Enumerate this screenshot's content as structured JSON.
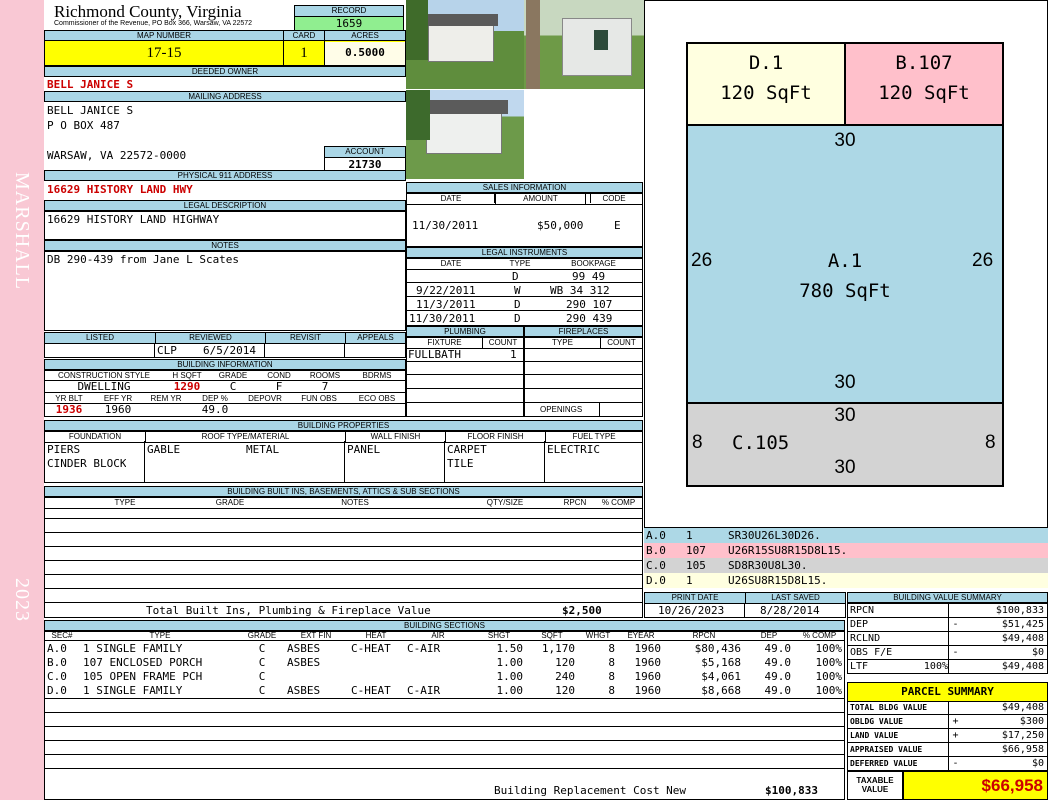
{
  "side": {
    "top_text": "MARSHALL",
    "bottom_text": "2023"
  },
  "header": {
    "county": "Richmond County, Virginia",
    "office": "Commissioner of the Revenue, PO Box 366, Warsaw, VA 22572",
    "record_label": "RECORD",
    "record": "1659",
    "map_label": "MAP NUMBER",
    "map": "17-15",
    "card_label": "CARD",
    "card": "1",
    "acres_label": "ACRES",
    "acres": "0.5000"
  },
  "owner": {
    "deeded_label": "DEEDED OWNER",
    "deeded": "BELL JANICE S",
    "mailing_label": "MAILING ADDRESS",
    "mail_lines": [
      "BELL JANICE S",
      "P O BOX 487",
      "",
      "WARSAW, VA 22572-0000"
    ],
    "account_label": "ACCOUNT",
    "account": "21730",
    "physical_label": "PHYSICAL 911 ADDRESS",
    "physical": "16629 HISTORY LAND HWY",
    "legal_label": "LEGAL DESCRIPTION",
    "legal": "16629 HISTORY LAND HIGHWAY",
    "notes_label": "NOTES",
    "notes": "DB 290-439 from Jane L Scates"
  },
  "review": {
    "listed_label": "LISTED",
    "reviewed_label": "REVIEWED",
    "revisit_label": "REVISIT",
    "appeals_label": "APPEALS",
    "reviewer": "CLP",
    "reviewed_date": "6/5/2014"
  },
  "building_info": {
    "title": "BUILDING INFORMATION",
    "h1": [
      "CONSTRUCTION STYLE",
      "H SQFT",
      "GRADE",
      "COND",
      "ROOMS",
      "BDRMS"
    ],
    "v1": [
      "DWELLING",
      "1290",
      "C",
      "F",
      "7",
      ""
    ],
    "h2": [
      "YR BLT",
      "EFF YR",
      "REM YR",
      "DEP %",
      "DEPOVR",
      "FUN OBS",
      "ECO OBS"
    ],
    "v2": [
      "1936",
      "1960",
      "",
      "49.0",
      "",
      "",
      ""
    ]
  },
  "sales": {
    "title": "SALES INFORMATION",
    "headers": [
      "DATE",
      "AMOUNT",
      "CODE"
    ],
    "rows": [
      [
        "11/30/2011",
        "$50,000",
        "E"
      ]
    ]
  },
  "legal_inst": {
    "title": "LEGAL INSTRUMENTS",
    "headers": [
      "DATE",
      "TYPE",
      "BOOKPAGE"
    ],
    "rows": [
      [
        "",
        "D",
        "99 49"
      ],
      [
        "9/22/2011",
        "W",
        "WB 34 312"
      ],
      [
        "11/3/2011",
        "D",
        "290 107"
      ],
      [
        "11/30/2011",
        "D",
        "290 439"
      ]
    ]
  },
  "plumbing": {
    "title": "PLUMBING",
    "headers": [
      "FIXTURE",
      "COUNT"
    ],
    "rows": [
      [
        "FULLBATH",
        "1"
      ]
    ]
  },
  "fireplaces": {
    "title": "FIREPLACES",
    "headers": [
      "TYPE",
      "COUNT"
    ],
    "openings_label": "OPENINGS"
  },
  "props": {
    "title": "BUILDING PROPERTIES",
    "headers": [
      "FOUNDATION",
      "ROOF TYPE/MATERIAL",
      "WALL FINISH",
      "FLOOR FINISH",
      "FUEL TYPE"
    ],
    "foundation": [
      "PIERS",
      "CINDER BLOCK"
    ],
    "roof_type": "GABLE",
    "roof_material": "METAL",
    "wall": "PANEL",
    "floor": [
      "CARPET",
      "TILE"
    ],
    "fuel": "ELECTRIC"
  },
  "builtins": {
    "title": "BUILDING BUILT INS, BASEMENTS, ATTICS & SUB SECTIONS",
    "headers": [
      "TYPE",
      "GRADE",
      "NOTES",
      "QTY/SIZE",
      "RPCN",
      "% COMP"
    ],
    "total_label": "Total Built Ins, Plumbing & Fireplace Value",
    "total": "$2,500"
  },
  "dates": {
    "print_label": "PRINT DATE",
    "print": "10/26/2023",
    "saved_label": "LAST SAVED",
    "saved": "8/28/2014"
  },
  "sections": {
    "title": "BUILDING SECTIONS",
    "headers": [
      "SEC#",
      "TYPE",
      "GRADE",
      "EXT FIN",
      "HEAT",
      "AIR",
      "SHGT",
      "SQFT",
      "WHGT",
      "EYEAR",
      "RPCN",
      "DEP",
      "% COMP"
    ],
    "rows": [
      [
        "A.0",
        "1 SINGLE FAMILY",
        "C",
        "ASBES",
        "C-HEAT",
        "C-AIR",
        "1.50",
        "1,170",
        "8",
        "1960",
        "$80,436",
        "49.0",
        "100%"
      ],
      [
        "B.0",
        "107 ENCLOSED PORCH",
        "C",
        "ASBES",
        "",
        "",
        "1.00",
        "120",
        "8",
        "1960",
        "$5,168",
        "49.0",
        "100%"
      ],
      [
        "C.0",
        "105 OPEN FRAME PCH",
        "C",
        "",
        "",
        "",
        "1.00",
        "240",
        "8",
        "1960",
        "$4,061",
        "49.0",
        "100%"
      ],
      [
        "D.0",
        "1 SINGLE FAMILY",
        "C",
        "ASBES",
        "C-HEAT",
        "C-AIR",
        "1.00",
        "120",
        "8",
        "1960",
        "$8,668",
        "49.0",
        "100%"
      ]
    ],
    "replacement_label": "Building Replacement Cost New",
    "replacement": "$100,833"
  },
  "sketch": {
    "d_label": "D.1",
    "d_area": "120 SqFt",
    "b_label": "B.107",
    "b_area": "120 SqFt",
    "a_label": "A.1",
    "a_area": "780 SqFt",
    "a_top": "30",
    "a_bottom": "30",
    "a_left": "26",
    "a_right": "26",
    "c_label": "C.105",
    "c_top": "30",
    "c_bottom": "30",
    "c_left": "8",
    "c_right": "8",
    "colors": {
      "a": "#add8e6",
      "b": "#ffc0cb",
      "c": "#d3d3d3",
      "d": "#ffffe0"
    }
  },
  "legend": [
    {
      "sec": "A.0",
      "code": "1",
      "path": "SR30U26L30D26."
    },
    {
      "sec": "B.0",
      "code": "107",
      "path": "U26R15SU8R15D8L15."
    },
    {
      "sec": "C.0",
      "code": "105",
      "path": "SD8R30U8L30."
    },
    {
      "sec": "D.0",
      "code": "1",
      "path": "U26SU8R15D8L15."
    }
  ],
  "bvs": {
    "title": "BUILDING VALUE SUMMARY",
    "rows": [
      {
        "label": "RPCN",
        "sign": "",
        "value": "$100,833"
      },
      {
        "label": "DEP",
        "sign": "-",
        "value": "$51,425"
      },
      {
        "label": "RCLND",
        "sign": "",
        "value": "$49,408"
      },
      {
        "label": "OBS F/E",
        "sign": "-",
        "value": "$0"
      },
      {
        "label": "LTF",
        "pct": "100%",
        "sign": "",
        "value": "$49,408"
      }
    ]
  },
  "parcel": {
    "title": "PARCEL SUMMARY",
    "rows": [
      {
        "label": "TOTAL BLDG VALUE",
        "sign": "",
        "value": "$49,408"
      },
      {
        "label": "OBLDG VALUE",
        "sign": "+",
        "value": "$300"
      },
      {
        "label": "LAND VALUE",
        "sign": "+",
        "value": "$17,250"
      },
      {
        "label": "APPRAISED VALUE",
        "sign": "",
        "value": "$66,958"
      },
      {
        "label": "DEFERRED VALUE",
        "sign": "-",
        "value": "$0"
      }
    ],
    "taxable_label_1": "TAXABLE",
    "taxable_label_2": "VALUE",
    "taxable": "$66,958"
  }
}
